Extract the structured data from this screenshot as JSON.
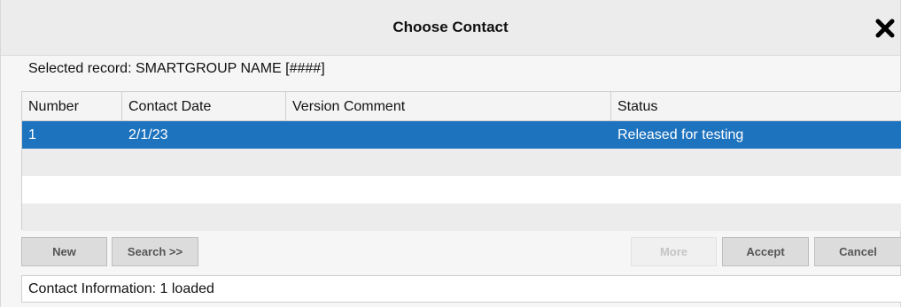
{
  "dialog": {
    "title": "Choose Contact",
    "close_icon": "close-icon"
  },
  "selected_record": "Selected record: SMARTGROUP NAME [####]",
  "table": {
    "columns": [
      "Number",
      "Contact Date",
      "Version Comment",
      "Status"
    ],
    "rows": [
      {
        "number": "1",
        "contact_date": "2/1/23",
        "version_comment": "",
        "status": "Released for testing",
        "selected": true
      }
    ]
  },
  "buttons": {
    "new": "New",
    "search": "Search >>",
    "more": "More",
    "accept": "Accept",
    "cancel": "Cancel"
  },
  "status_bar": "Contact Information: 1 loaded",
  "colors": {
    "selection": "#1e73be",
    "header_bg": "#ececec"
  }
}
